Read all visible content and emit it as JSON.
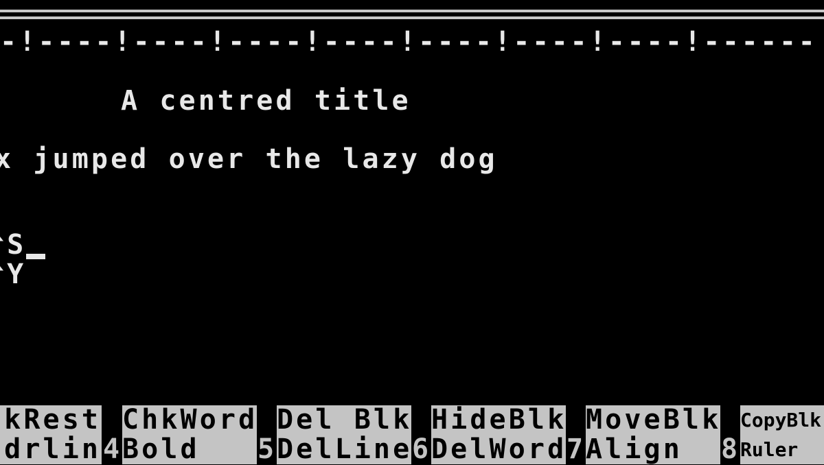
{
  "ruler": "-!----!----!----!----!----!----!----!------",
  "document": {
    "lines": [
      "A centred title",
      "x jumped over the lazy dog",
      "^S",
      "^Y"
    ]
  },
  "function_keys": {
    "row1": [
      "hkRest",
      "ChkWord",
      "Del Blk",
      "HideBlk",
      "MoveBlk",
      "CopyBlk"
    ],
    "row2": [
      "ndrlin",
      "Bold",
      "DelLine",
      "DelWord",
      "Align",
      "Ruler"
    ],
    "numbers": [
      "4",
      "5",
      "6",
      "7",
      "8"
    ]
  }
}
